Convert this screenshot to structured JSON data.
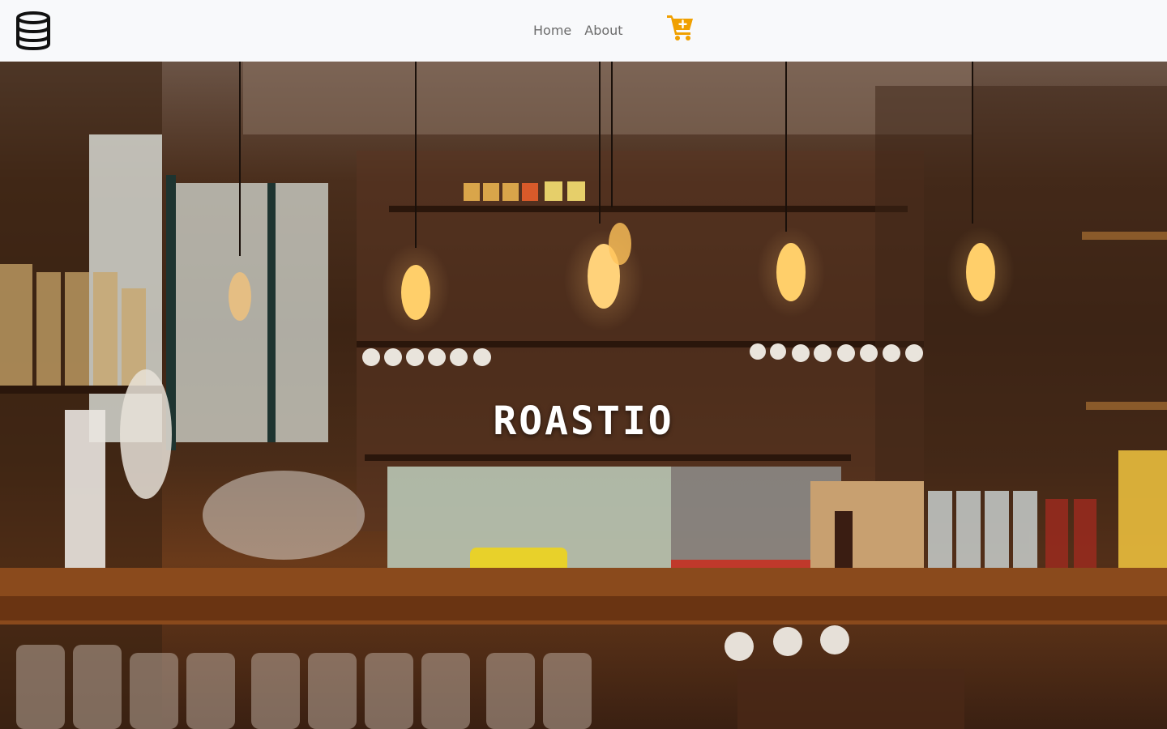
{
  "navbar": {
    "logo_icon": "database-icon",
    "links": [
      {
        "label": "Home"
      },
      {
        "label": "About"
      }
    ],
    "cart_icon": "cart-plus-icon",
    "cart_color": "#f0a000",
    "background": "#f8f9fb"
  },
  "hero": {
    "title": "ROASTIO",
    "title_color": "#ffffff",
    "background_image": "cafe-bar-interior-photo"
  }
}
